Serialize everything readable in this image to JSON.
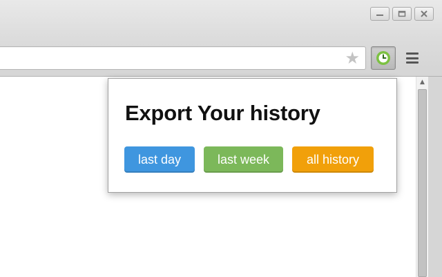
{
  "colors": {
    "last_day": "#3f96df",
    "last_week": "#7cb85a",
    "all_history": "#f1a00a",
    "extension_icon_accent": "#7cc142"
  },
  "window_controls": {
    "minimize_icon": "minimize-icon",
    "maximize_icon": "maximize-icon",
    "close_icon": "close-icon"
  },
  "toolbar": {
    "bookmark_icon": "star-icon",
    "extension_icon": "clock-icon",
    "menu_icon": "hamburger-menu-icon"
  },
  "popup": {
    "title": "Export Your history",
    "buttons": {
      "last_day": "last day",
      "last_week": "last week",
      "all_history": "all history"
    }
  }
}
